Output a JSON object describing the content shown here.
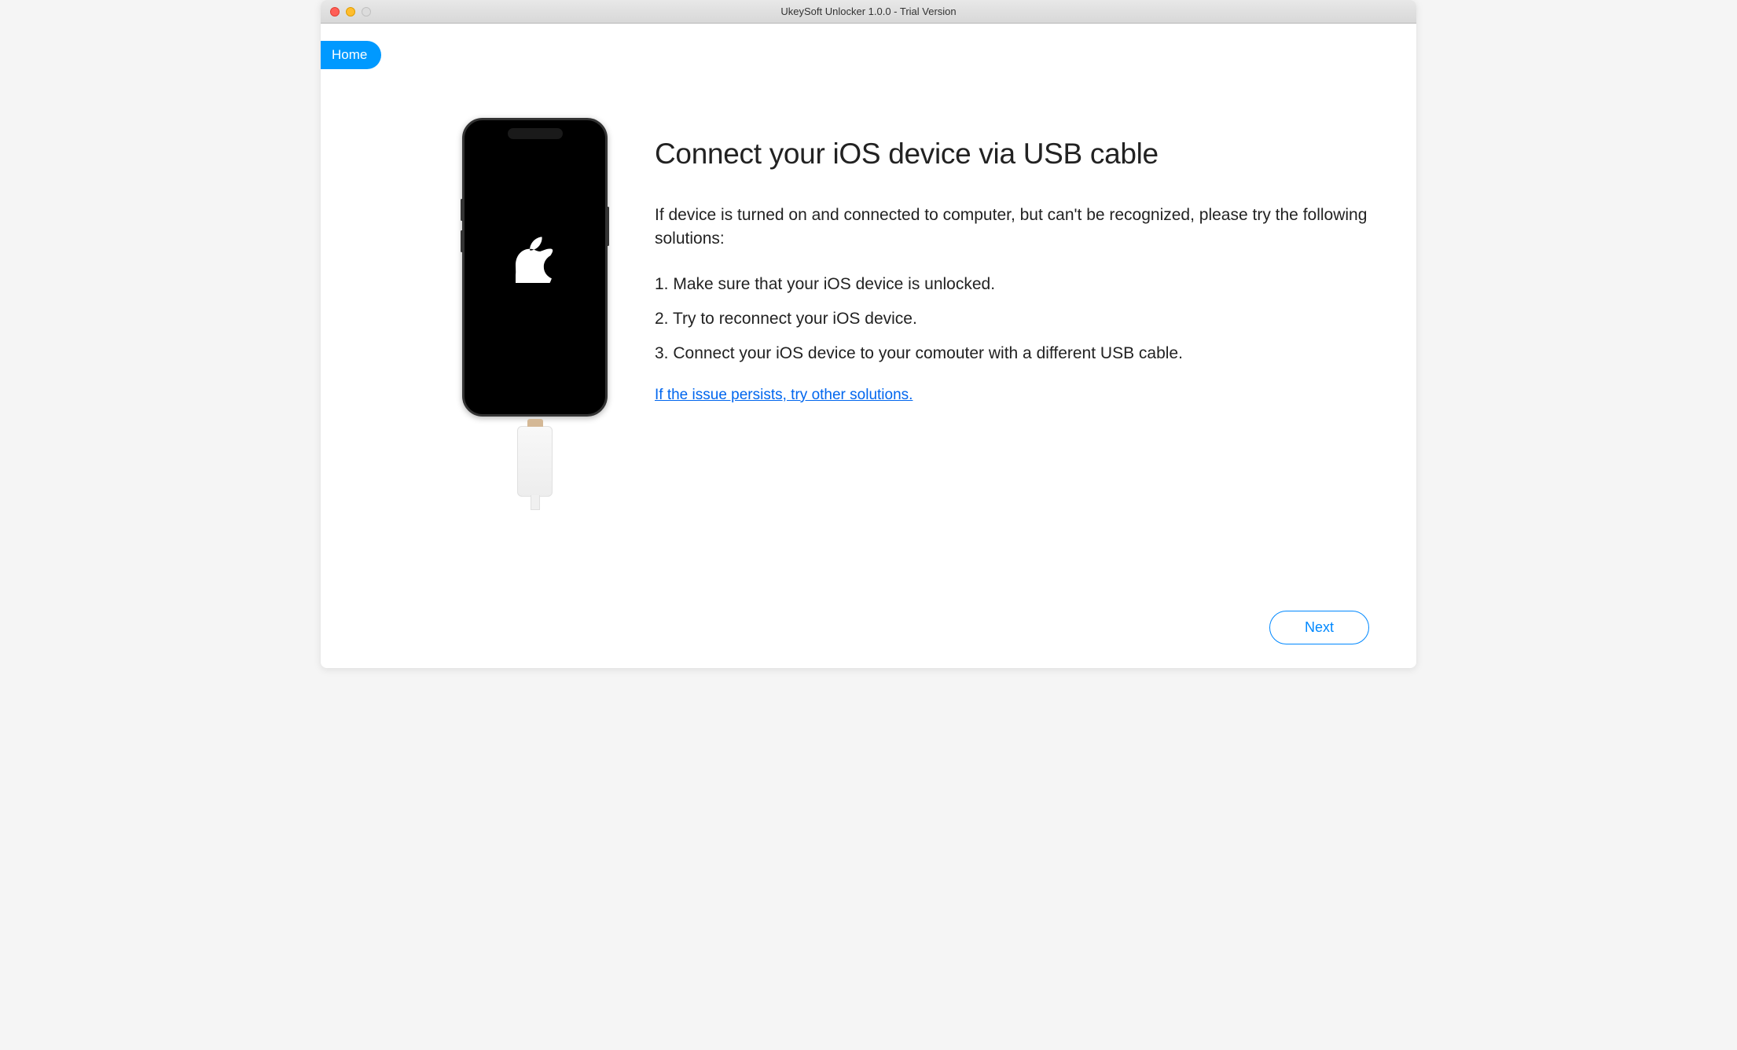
{
  "window": {
    "title": "UkeySoft Unlocker 1.0.0 - Trial Version"
  },
  "nav": {
    "home_label": "Home"
  },
  "main": {
    "heading": "Connect your iOS device via USB cable",
    "description": "If device is turned on and connected to computer, but can't be recognized, please try the following solutions:",
    "steps": [
      "1. Make sure that your iOS device is unlocked.",
      "2. Try to reconnect your iOS device.",
      "3. Connect your iOS device to your comouter with a different USB cable."
    ],
    "link_text": "If the issue persists, try other solutions."
  },
  "footer": {
    "next_label": "Next"
  }
}
